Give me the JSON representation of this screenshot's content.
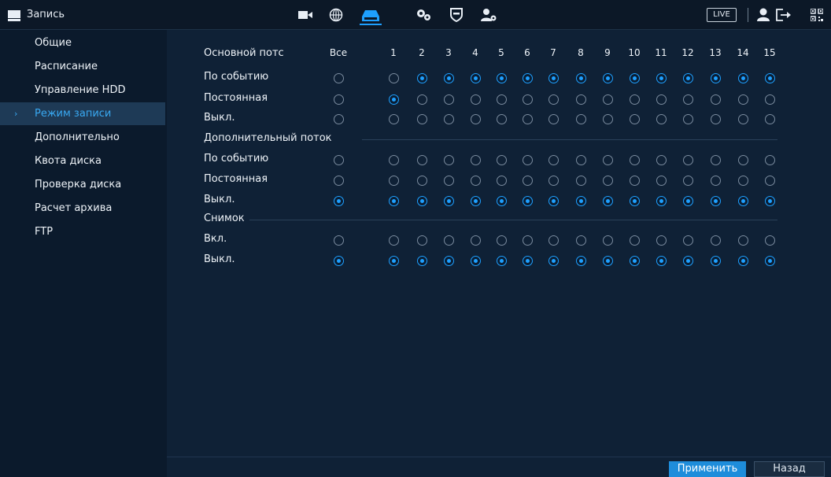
{
  "header": {
    "title": "Запись",
    "live_label": "LIVE",
    "icons": [
      "camera-icon",
      "network-icon",
      "storage-icon",
      "settings-icon",
      "shield-icon",
      "user-settings-icon",
      "user-icon",
      "logout-icon",
      "qr-code-icon"
    ]
  },
  "sidebar": {
    "items": [
      {
        "label": "Общие"
      },
      {
        "label": "Расписание"
      },
      {
        "label": "Управление HDD"
      },
      {
        "label": "Режим записи"
      },
      {
        "label": "Дополнительно"
      },
      {
        "label": "Квота диска"
      },
      {
        "label": "Проверка диска"
      },
      {
        "label": "Расчет архива"
      },
      {
        "label": "FTP"
      }
    ],
    "active_index": 3
  },
  "main": {
    "header_row_label": "Основной потс",
    "all_label": "Все",
    "channels": [
      "1",
      "2",
      "3",
      "4",
      "5",
      "6",
      "7",
      "8",
      "9",
      "10",
      "11",
      "12",
      "13",
      "14",
      "15"
    ],
    "sections": [
      {
        "title": "",
        "rows": [
          {
            "label": "По событию",
            "all": false,
            "values": [
              false,
              true,
              true,
              true,
              true,
              true,
              true,
              true,
              true,
              true,
              true,
              true,
              true,
              true,
              true
            ]
          },
          {
            "label": "Постоянная",
            "all": false,
            "values": [
              true,
              false,
              false,
              false,
              false,
              false,
              false,
              false,
              false,
              false,
              false,
              false,
              false,
              false,
              false
            ]
          },
          {
            "label": "Выкл.",
            "all": false,
            "values": [
              false,
              false,
              false,
              false,
              false,
              false,
              false,
              false,
              false,
              false,
              false,
              false,
              false,
              false,
              false
            ]
          }
        ]
      },
      {
        "title": "Дополнительный поток",
        "rows": [
          {
            "label": "По событию",
            "all": false,
            "values": [
              false,
              false,
              false,
              false,
              false,
              false,
              false,
              false,
              false,
              false,
              false,
              false,
              false,
              false,
              false
            ]
          },
          {
            "label": "Постоянная",
            "all": false,
            "values": [
              false,
              false,
              false,
              false,
              false,
              false,
              false,
              false,
              false,
              false,
              false,
              false,
              false,
              false,
              false
            ]
          },
          {
            "label": "Выкл.",
            "all": true,
            "values": [
              true,
              true,
              true,
              true,
              true,
              true,
              true,
              true,
              true,
              true,
              true,
              true,
              true,
              true,
              true
            ]
          }
        ]
      },
      {
        "title": "Снимок",
        "rows": [
          {
            "label": "Вкл.",
            "all": false,
            "values": [
              false,
              false,
              false,
              false,
              false,
              false,
              false,
              false,
              false,
              false,
              false,
              false,
              false,
              false,
              false
            ]
          },
          {
            "label": "Выкл.",
            "all": true,
            "values": [
              true,
              true,
              true,
              true,
              true,
              true,
              true,
              true,
              true,
              true,
              true,
              true,
              true,
              true,
              true
            ]
          }
        ]
      }
    ]
  },
  "footer": {
    "apply_label": "Применить",
    "back_label": "Назад"
  },
  "colors": {
    "accent": "#1ea0ff",
    "active_text": "#39a9f2"
  }
}
